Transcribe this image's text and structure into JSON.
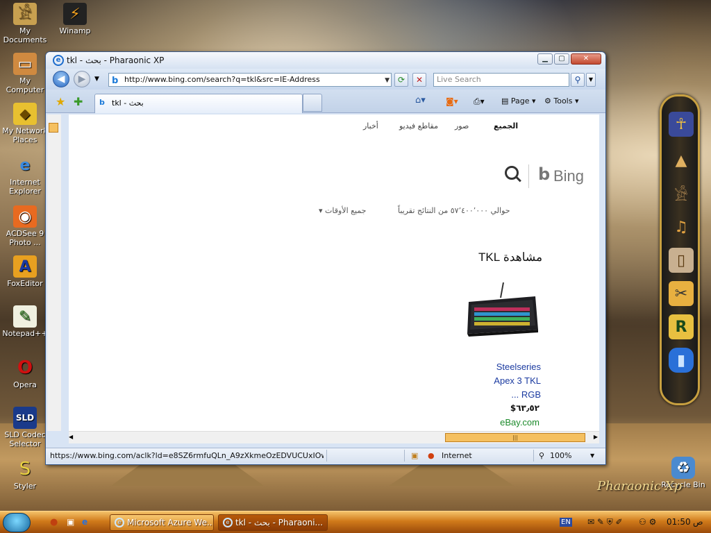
{
  "desktop": {
    "icons": [
      {
        "label": "My\nDocuments",
        "name": "my-documents"
      },
      {
        "label": "Winamp",
        "name": "winamp"
      },
      {
        "label": "My Computer",
        "name": "my-computer"
      },
      {
        "label": "My Network\nPlaces",
        "name": "my-network-places"
      },
      {
        "label": "Internet\nExplorer",
        "name": "internet-explorer"
      },
      {
        "label": "ACDSee 9\nPhoto ...",
        "name": "acdsee"
      },
      {
        "label": "FoxEditor",
        "name": "foxeditor"
      },
      {
        "label": "Notepad++",
        "name": "notepad-plus-plus"
      },
      {
        "label": "Opera",
        "name": "opera"
      },
      {
        "label": "SLD Codec\nSelector",
        "name": "sld-codec-selector"
      },
      {
        "label": "Styler",
        "name": "styler"
      },
      {
        "label": "Recycle Bin",
        "name": "recycle-bin"
      }
    ],
    "brand_logo": "Pharaonic Xp"
  },
  "window": {
    "title": "tkl - بحث - Pharaonic XP",
    "address": "http://www.bing.com/search?q=tkl&src=IE-Address",
    "search_placeholder": "Live Search",
    "tab_title": "tkl - بحث",
    "toolbar": {
      "page_label": "Page",
      "tools_label": "Tools"
    }
  },
  "page": {
    "nav_tabs": {
      "all": "الجميع",
      "images": "صور",
      "videos": "مقاطع فيديو",
      "news": "أخبار"
    },
    "bing_logo": "Bing",
    "results_count": "حوالي ٥٧٬٤٠٠٬٠٠٠ من النتائج تقريباً",
    "time_filter": "جميع الأوقات",
    "section_title": "مشاهدة TKL",
    "product": {
      "line1": "Steelseries",
      "line2": "Apex 3 TKL",
      "line3": "RGB ...",
      "price": "$٦٣٫٥٢",
      "seller": "eBay.com"
    }
  },
  "status": {
    "url": "https://www.bing.com/aclk?ld=e8SZ6rmfuQLn_A9zXkmeOzEDVUCUxIOwMa00t2y",
    "zone": "Internet",
    "zoom": "100%"
  },
  "taskbar": {
    "tasks": [
      {
        "label": "Microsoft Azure We...",
        "active": false
      },
      {
        "label": "tkl - بحث - Pharaoni...",
        "active": true
      }
    ],
    "language": "EN",
    "clock": "01:50",
    "ampm": "ص"
  }
}
